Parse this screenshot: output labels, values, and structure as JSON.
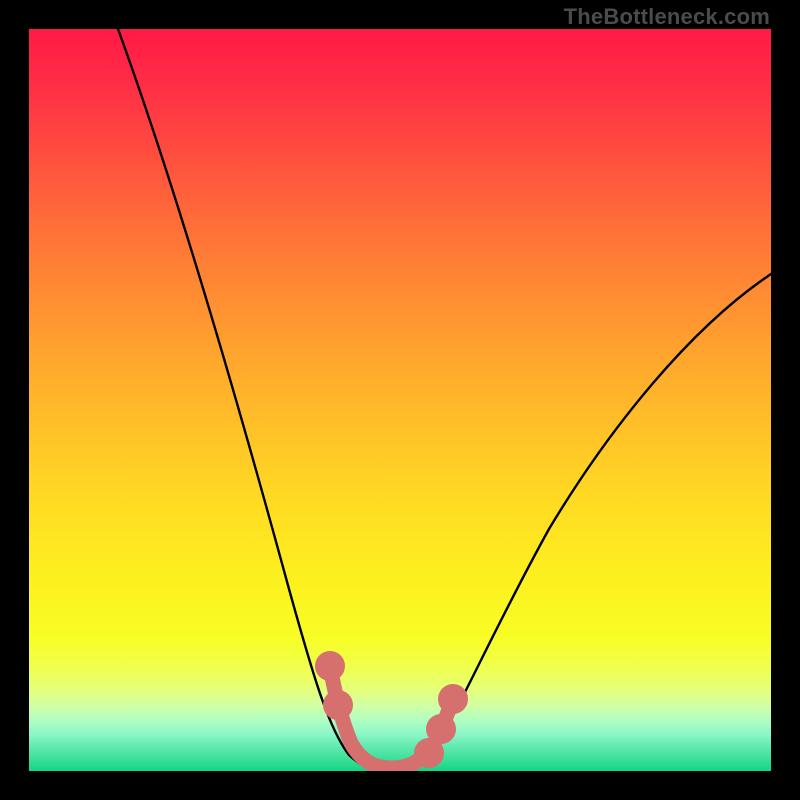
{
  "watermark": "TheBottleneck.com",
  "chart_data": {
    "type": "line",
    "title": "",
    "xlabel": "",
    "ylabel": "",
    "xlim": [
      0,
      100
    ],
    "ylim": [
      0,
      100
    ],
    "grid": false,
    "legend": false,
    "series": [
      {
        "name": "black-curve",
        "color": "#000000",
        "x": [
          12,
          15,
          18,
          21,
          24,
          27,
          30,
          33,
          36,
          39,
          41,
          43,
          45,
          47,
          50,
          53,
          55,
          58,
          61,
          65,
          70,
          75,
          80,
          85,
          90,
          95,
          100
        ],
        "values": [
          100,
          91,
          82,
          73,
          64,
          55,
          46,
          38,
          30,
          22,
          16,
          10,
          5,
          2,
          2,
          2,
          4,
          8,
          13,
          20,
          29,
          37,
          44,
          51,
          57,
          62,
          67
        ]
      },
      {
        "name": "pink-highlight",
        "color": "#d6706f",
        "x": [
          41,
          43,
          44,
          46,
          48,
          50,
          52,
          54,
          56
        ],
        "values": [
          14,
          8,
          4,
          2,
          2,
          2,
          2,
          4,
          8
        ]
      }
    ],
    "gradient_stops": [
      {
        "pos": 0.0,
        "color": "#ff1a47"
      },
      {
        "pos": 0.25,
        "color": "#ff6a3a"
      },
      {
        "pos": 0.55,
        "color": "#ffc427"
      },
      {
        "pos": 0.82,
        "color": "#f8fd25"
      },
      {
        "pos": 0.93,
        "color": "#b3ffc0"
      },
      {
        "pos": 1.0,
        "color": "#10d784"
      }
    ]
  }
}
